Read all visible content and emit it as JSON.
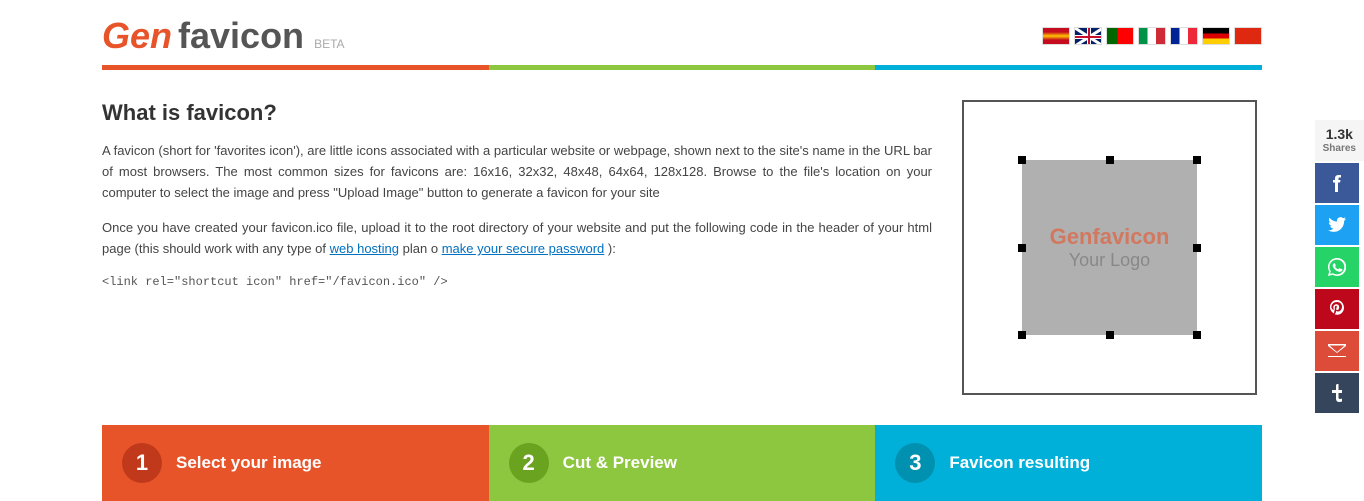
{
  "header": {
    "logo_gen": "Gen",
    "logo_favicon": "favicon",
    "logo_beta": "BETA",
    "title": "Genfavicon"
  },
  "page": {
    "title": "What is favicon?",
    "description1": "A favicon (short for 'favorites icon'), are little icons associated with a particular website or webpage, shown next to the site's name in the URL bar of most browsers. The most common sizes for favicons are: 16x16, 32x32, 48x48, 64x64, 128x128. Browse to the file's location on your computer to select the image and press \"Upload Image\" button to generate a favicon for your site",
    "description2": "Once you have created your favicon.ico file, upload it to the root directory of your website and put the following code in the header of your html page (this should work with any type of",
    "link1": "web hosting",
    "link2_pre": "plan o",
    "link2": "make your secure password",
    "link2_post": "):",
    "code_snippet": "<link rel=\"shortcut icon\" href=\"/favicon.ico\" />"
  },
  "preview": {
    "logo_text": "Genfavicon",
    "your_logo": "Your Logo"
  },
  "steps": [
    {
      "number": "1",
      "label": "Select your image",
      "color": "orange"
    },
    {
      "number": "2",
      "label": "Cut & Preview",
      "color": "green"
    },
    {
      "number": "3",
      "label": "Favicon resulting",
      "color": "blue"
    }
  ],
  "social": {
    "count": "1.3k",
    "shares_label": "Shares",
    "buttons": [
      "facebook",
      "twitter",
      "whatsapp",
      "pinterest",
      "email",
      "tumblr"
    ]
  },
  "flags": [
    "es",
    "en",
    "pt",
    "it",
    "fr",
    "de",
    "zh"
  ]
}
